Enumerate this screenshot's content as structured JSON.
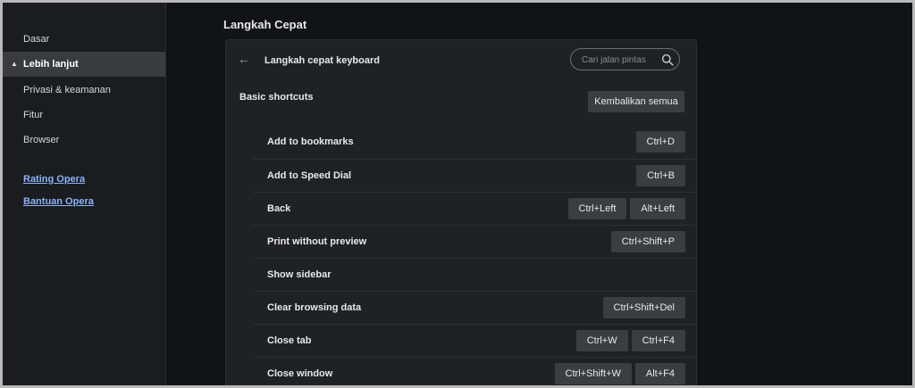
{
  "sidebar": {
    "items": [
      {
        "label": "Dasar"
      },
      {
        "label": "Lebih lanjut"
      },
      {
        "label": "Privasi & keamanan"
      },
      {
        "label": "Fitur"
      },
      {
        "label": "Browser"
      }
    ],
    "links": [
      {
        "label": "Rating Opera"
      },
      {
        "label": "Bantuan Opera"
      }
    ]
  },
  "page": {
    "title": "Langkah Cepat"
  },
  "panel": {
    "title": "Langkah cepat keyboard",
    "search_placeholder": "Cari jalan pintas",
    "section_title": "Basic shortcuts",
    "reset_label": "Kembalikan semua"
  },
  "shortcuts": [
    {
      "label": "Add to bookmarks",
      "keys": [
        "Ctrl+D"
      ]
    },
    {
      "label": "Add to Speed Dial",
      "keys": [
        "Ctrl+B"
      ]
    },
    {
      "label": "Back",
      "keys": [
        "Ctrl+Left",
        "Alt+Left"
      ]
    },
    {
      "label": "Print without preview",
      "keys": [
        "Ctrl+Shift+P"
      ]
    },
    {
      "label": "Show sidebar",
      "keys": []
    },
    {
      "label": "Clear browsing data",
      "keys": [
        "Ctrl+Shift+Del"
      ]
    },
    {
      "label": "Close tab",
      "keys": [
        "Ctrl+W",
        "Ctrl+F4"
      ]
    },
    {
      "label": "Close window",
      "keys": [
        "Ctrl+Shift+W",
        "Alt+F4"
      ]
    }
  ],
  "icons": {
    "back": "arrow-left-icon",
    "search": "search-icon",
    "caret": "caret-up-icon"
  },
  "colors": {
    "link": "#8ab4f8",
    "background": "#121316",
    "sidebar": "#1b1c1f",
    "panel": "#202124",
    "button": "#3b3d41"
  }
}
